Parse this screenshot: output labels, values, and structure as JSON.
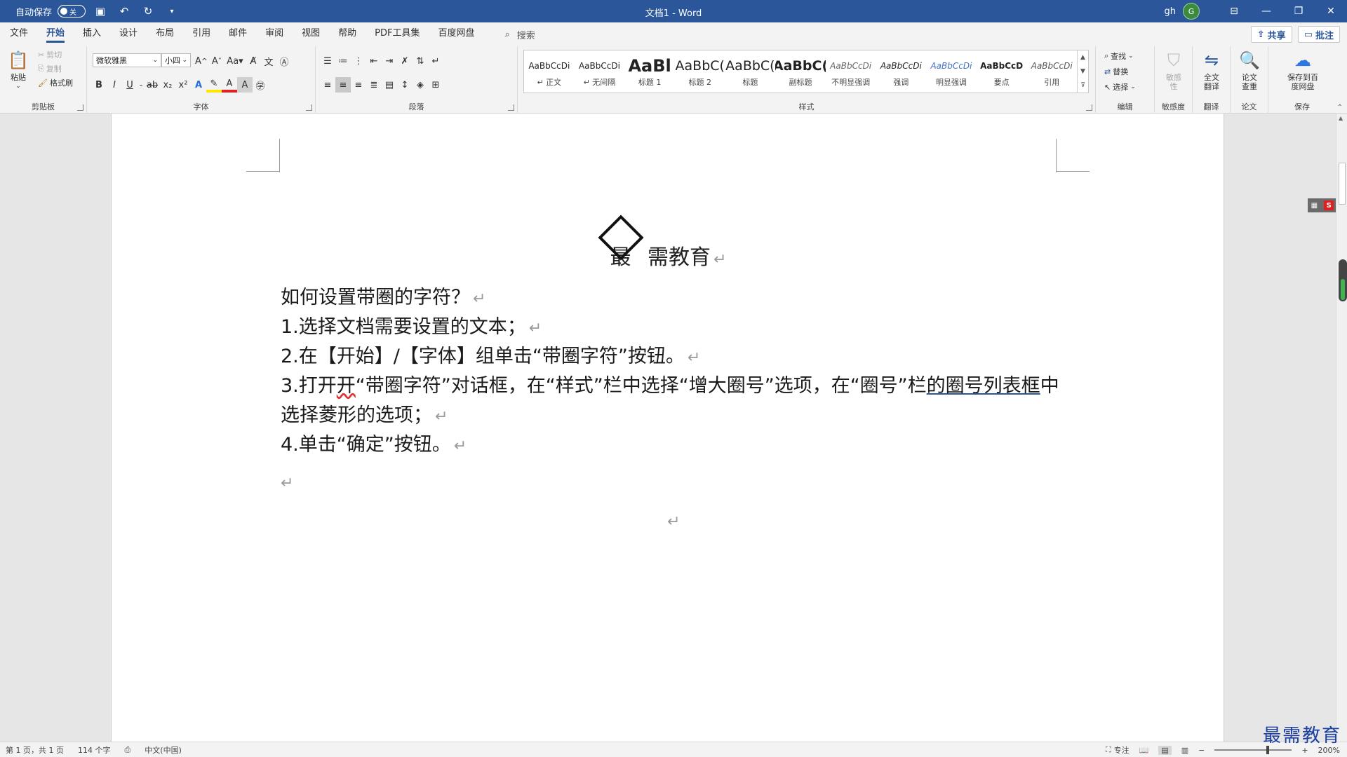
{
  "titlebar": {
    "autosave_label": "自动保存",
    "autosave_state": "关",
    "doc_title": "文档1  -  Word",
    "user_name": "gh",
    "avatar_letter": "G"
  },
  "menu": {
    "tabs": [
      "文件",
      "开始",
      "插入",
      "设计",
      "布局",
      "引用",
      "邮件",
      "审阅",
      "视图",
      "帮助",
      "PDF工具集",
      "百度网盘"
    ],
    "active_tab": "开始",
    "search_label": "搜索",
    "share_label": "共享",
    "comment_label": "批注"
  },
  "ribbon": {
    "clipboard": {
      "paste": "粘贴",
      "cut": "剪切",
      "copy": "复制",
      "format_painter": "格式刷",
      "group_label": "剪贴板"
    },
    "font": {
      "font_name": "微软雅黑",
      "font_size": "小四",
      "group_label": "字体"
    },
    "paragraph": {
      "group_label": "段落"
    },
    "styles": {
      "group_label": "样式",
      "items": [
        {
          "sample": "AaBbCcDi",
          "name": "↵ 正文"
        },
        {
          "sample": "AaBbCcDi",
          "name": "↵ 无间隔"
        },
        {
          "sample": "AaBl",
          "name": "标题 1"
        },
        {
          "sample": "AaBbC(",
          "name": "标题 2"
        },
        {
          "sample": "AaBbC(",
          "name": "标题"
        },
        {
          "sample": "AaBbC(",
          "name": "副标题"
        },
        {
          "sample": "AaBbCcDi",
          "name": "不明显强调"
        },
        {
          "sample": "AaBbCcDi",
          "name": "强调"
        },
        {
          "sample": "AaBbCcDi",
          "name": "明显强调"
        },
        {
          "sample": "AaBbCcD",
          "name": "要点"
        },
        {
          "sample": "AaBbCcDi",
          "name": "引用"
        }
      ]
    },
    "editing": {
      "find": "查找",
      "replace": "替换",
      "select": "选择",
      "group_label": "编辑"
    },
    "sensitivity": {
      "button": "敏感性",
      "group_label": "敏感度"
    },
    "translate": {
      "button": "全文翻译",
      "group_label": "翻译"
    },
    "paper": {
      "button": "论文查重",
      "group_label": "论文"
    },
    "save": {
      "button": "保存到百度网盘",
      "group_label": "保存"
    }
  },
  "document": {
    "heading_enclosed_char": "最",
    "heading_rest": "需教育",
    "question": "如何设置带圈的字符？",
    "step1": "1.选择文档需要设置的文本；",
    "step2": "2.在【开始】/【字体】组单击“带圈字符”按钮。",
    "step3_a": "3.打开",
    "step3_b": "开",
    "step3_c": "“带圈字符”对话框，在“样式”栏中选择“增大圈号”选项，在“圈号”栏",
    "step3_d": "的圈号列表框",
    "step3_e": "中",
    "step3_line2": "选择菱形的选项；",
    "step4": "4.单击“确定”按钮。"
  },
  "statusbar": {
    "page": "第 1 页，共 1 页",
    "words": "114 个字",
    "language": "中文(中国)",
    "focus": "专注",
    "zoom": "200%"
  },
  "watermark": "最需教育",
  "colors": {
    "accent": "#2b579a"
  }
}
